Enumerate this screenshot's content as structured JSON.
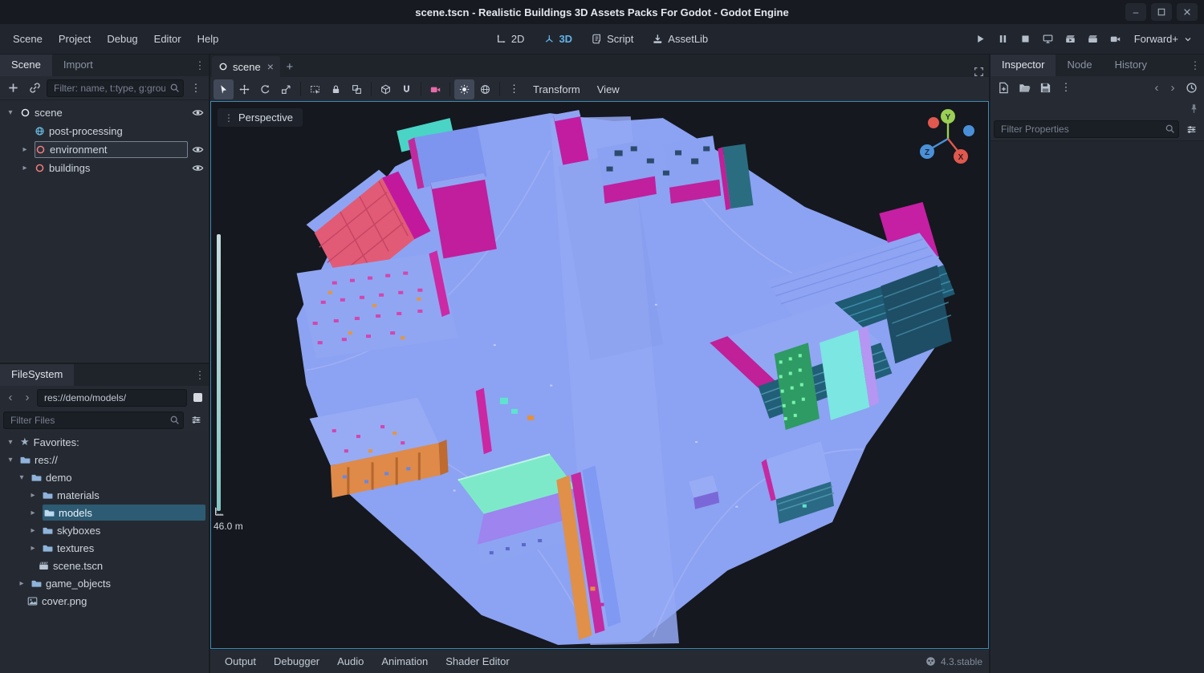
{
  "window": {
    "title": "scene.tscn - Realistic Buildings 3D Assets Packs For Godot - Godot Engine"
  },
  "icons": {
    "dots": "⋮",
    "expand": "▸",
    "collapse": "▾",
    "chevron_left": "‹",
    "chevron_right": "›",
    "close": "×",
    "star": "★",
    "minus": "–",
    "plus": "+"
  },
  "menubar": {
    "items": [
      "Scene",
      "Project",
      "Debug",
      "Editor",
      "Help"
    ]
  },
  "switcher": {
    "items": [
      "2D",
      "3D",
      "Script",
      "AssetLib"
    ]
  },
  "runbar": {
    "renderer": "Forward+"
  },
  "scene_dock": {
    "tabs": [
      "Scene",
      "Import"
    ],
    "filter_placeholder": "Filter: name, t:type, g:group",
    "tree": [
      {
        "label": "scene"
      },
      {
        "label": "post-processing"
      },
      {
        "label": "environment"
      },
      {
        "label": "buildings"
      }
    ]
  },
  "filesystem": {
    "tab": "FileSystem",
    "path": "res://demo/models/",
    "filter_placeholder": "Filter Files",
    "tree": [
      {
        "label": "Favorites:"
      },
      {
        "label": "res://"
      },
      {
        "label": "demo"
      },
      {
        "label": "materials"
      },
      {
        "label": "models"
      },
      {
        "label": "skyboxes"
      },
      {
        "label": "textures"
      },
      {
        "label": "scene.tscn"
      },
      {
        "label": "game_objects"
      },
      {
        "label": "cover.png"
      }
    ]
  },
  "viewport": {
    "tab_label": "scene",
    "perspective_label": "Perspective",
    "transform_menu": "Transform",
    "view_menu": "View",
    "scale_label": "46.0 m",
    "gizmo": {
      "x": "X",
      "y": "Y",
      "z": "Z"
    }
  },
  "bottom_panel": {
    "items": [
      "Output",
      "Debugger",
      "Audio",
      "Animation",
      "Shader Editor"
    ],
    "version": "4.3.stable"
  },
  "inspector": {
    "tabs": [
      "Inspector",
      "Node",
      "History"
    ],
    "filter_placeholder": "Filter Properties"
  },
  "colors": {
    "accent": "#61b3e8",
    "selection": "#2d5b74",
    "viewport_border": "#3e88b3",
    "ground": "#8ca2f2",
    "building_magenta": "#c01e9c",
    "building_pink": "#e25b76",
    "building_teal": "#1e5a72",
    "building_orange": "#df8a49"
  }
}
